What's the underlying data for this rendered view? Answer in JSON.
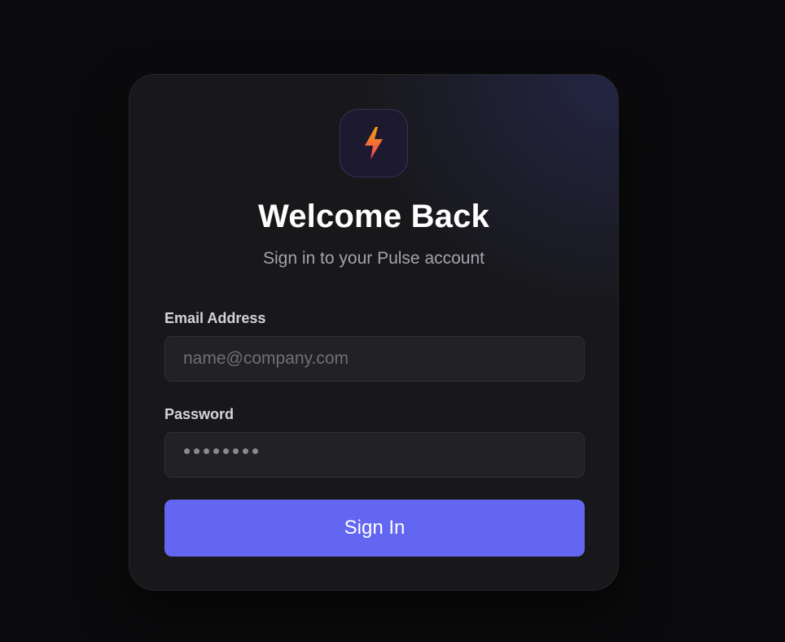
{
  "brand": {
    "icon": "lightning-bolt-icon",
    "icon_colors": [
      "#f59e0b",
      "#f43f5e"
    ],
    "accent": "#6366f1"
  },
  "header": {
    "title": "Welcome Back",
    "subtitle": "Sign in to your Pulse account"
  },
  "form": {
    "email": {
      "label": "Email Address",
      "value": "",
      "placeholder": "name@company.com"
    },
    "password": {
      "label": "Password",
      "placeholder": "••••••••",
      "masked_length": 8
    },
    "submit_label": "Sign In"
  }
}
